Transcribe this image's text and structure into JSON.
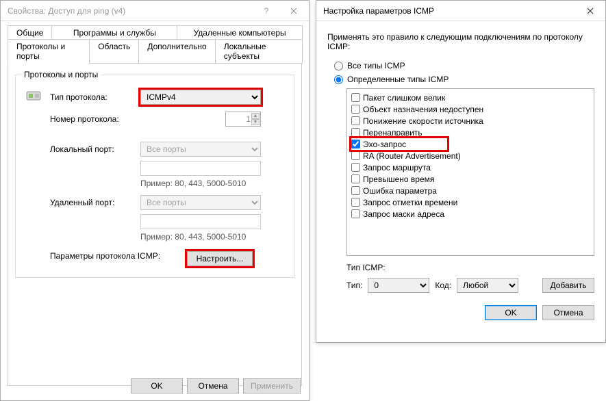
{
  "dlg1": {
    "title": "Свойства: Доступ для ping (v4)",
    "tabs_row1": [
      "Общие",
      "Программы и службы",
      "Удаленные компьютеры"
    ],
    "tabs_row2": [
      "Протоколы и порты",
      "Область",
      "Дополнительно",
      "Локальные субъекты"
    ],
    "active_tab": "Протоколы и порты",
    "group_title": "Протоколы и порты",
    "proto_type_label": "Тип протокола:",
    "proto_type_value": "ICMPv4",
    "proto_num_label": "Номер протокола:",
    "proto_num_value": "1",
    "local_port_label": "Локальный порт:",
    "all_ports": "Все порты",
    "example": "Пример: 80, 443, 5000-5010",
    "remote_port_label": "Удаленный порт:",
    "icmp_params_label": "Параметры протокола ICMP:",
    "configure_btn": "Настроить...",
    "ok": "OK",
    "cancel": "Отмена",
    "apply": "Применить"
  },
  "dlg2": {
    "title": "Настройка параметров ICMP",
    "intro": "Применять это правило к следующим подключениям по протоколу ICMP:",
    "radio_all": "Все типы ICMP",
    "radio_specific": "Определенные типы ICMP",
    "items": [
      {
        "label": "Пакет слишком велик",
        "checked": false
      },
      {
        "label": "Объект назначения недоступен",
        "checked": false
      },
      {
        "label": "Понижение скорости источника",
        "checked": false
      },
      {
        "label": "Перенаправить",
        "checked": false
      },
      {
        "label": "Эхо-запрос",
        "checked": true,
        "highlight": true
      },
      {
        "label": "RA (Router Advertisement)",
        "checked": false
      },
      {
        "label": "Запрос маршрута",
        "checked": false
      },
      {
        "label": "Превышено время",
        "checked": false
      },
      {
        "label": "Ошибка параметра",
        "checked": false
      },
      {
        "label": "Запрос отметки времени",
        "checked": false
      },
      {
        "label": "Запрос маски адреса",
        "checked": false
      }
    ],
    "tip_label": "Тип ICMP:",
    "type_label": "Тип:",
    "type_value": "0",
    "code_label": "Код:",
    "code_value": "Любой",
    "add_btn": "Добавить",
    "ok": "OK",
    "cancel": "Отмена"
  }
}
